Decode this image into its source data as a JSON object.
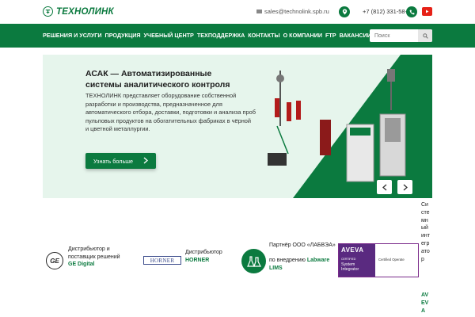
{
  "header": {
    "logo_text": "ТЕХНОЛИНК",
    "email": "sales@technolink.spb.ru",
    "phone": "+7 (812) 331-58-30",
    "icons": [
      "logo-mark-icon",
      "envelope-icon",
      "location-pin-icon",
      "phone-icon",
      "youtube-icon"
    ],
    "brand_color": "#0b7a3f",
    "youtube_color": "#e62117"
  },
  "nav": {
    "items": [
      {
        "label": "РЕШЕНИЯ И УСЛУГИ"
      },
      {
        "label": "ПРОДУКЦИЯ"
      },
      {
        "label": "УЧЕБНЫЙ ЦЕНТР"
      },
      {
        "label": "ТЕХПОДДЕРЖКА"
      },
      {
        "label": "КОНТАКТЫ"
      },
      {
        "label": "О КОМПАНИИ"
      },
      {
        "label": "FTP"
      },
      {
        "label": "ВАКАНСИИ"
      }
    ],
    "search_placeholder": "Поиск",
    "background_color": "#0b7a3f"
  },
  "banner": {
    "title": "АСАК — Автоматизированные системы аналитического контроля",
    "description": "ТЕХНОЛИНК представляет оборудование собственной разработки и производства, предназначенное для автоматического отбора, доставки, подготовки и анализа проб пульповых продуктов на обогатительных фабриках в чёрной и цветной металлургии.",
    "button_label": "Узнать больше",
    "background_color": "#e6f5ec"
  },
  "partners": {
    "ge": {
      "text": "Дистрибьютор и поставщик решений",
      "link": "GE Digital",
      "logo_text": "GE"
    },
    "horner": {
      "logo_text": "HORNER",
      "text": "Дистрибьютор",
      "link": "HORNER"
    },
    "labvea": {
      "text_1": "Партнёр ООО «ЛАБВЭА»",
      "text_2": "по внедрению",
      "link": "Labware LIMS"
    },
    "aveva": {
      "logo_name": "AVEVA",
      "certified": "CERTIFIED",
      "system": "System",
      "integrator": "Integrator",
      "operate": "Certified Operate",
      "border_color": "#7a2a8a",
      "fill_color": "#5a2a80"
    },
    "vertical_text": "Системный интегратор",
    "vertical_link": "AVEVA"
  }
}
